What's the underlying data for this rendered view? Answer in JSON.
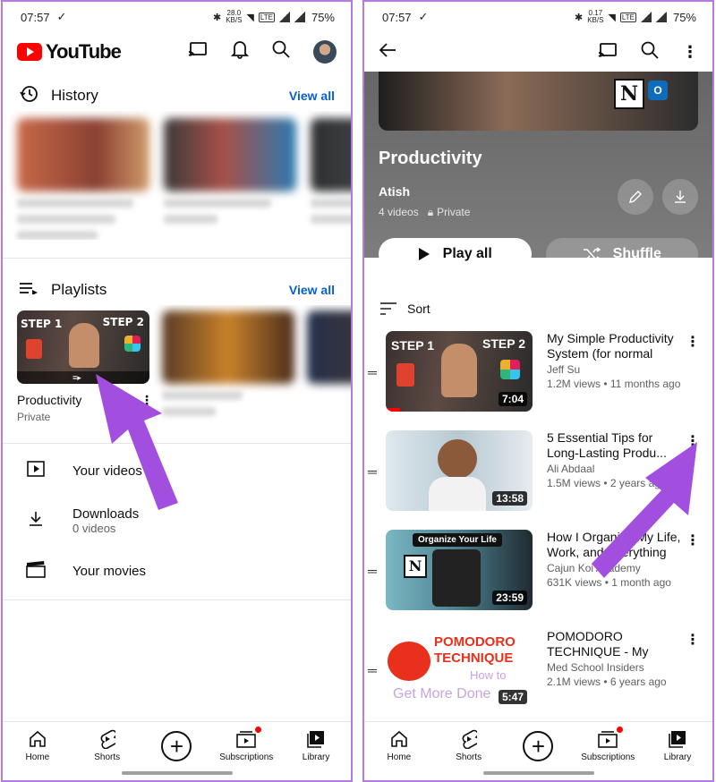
{
  "status_left": {
    "time": "07:57",
    "speed": "28.0\nKB/S",
    "battery": "75%"
  },
  "status_right": {
    "time": "07:57",
    "speed": "0.17\nKB/S",
    "battery": "75%"
  },
  "left": {
    "logo_text": "YouTube",
    "history": {
      "title": "History",
      "view_all": "View all"
    },
    "playlists": {
      "title": "Playlists",
      "view_all": "View all",
      "items": [
        {
          "title": "Productivity",
          "privacy": "Private"
        }
      ]
    },
    "menu": {
      "your_videos": "Your videos",
      "downloads": "Downloads",
      "downloads_sub": "0 videos",
      "your_movies": "Your movies"
    }
  },
  "right": {
    "playlist_title": "Productivity",
    "owner": "Atish",
    "video_count": "4 videos",
    "privacy": "Private",
    "play_all": "Play all",
    "shuffle": "Shuffle",
    "sort": "Sort",
    "videos": [
      {
        "title": "My Simple Productivity System (for normal peo...",
        "channel": "Jeff Su",
        "meta": "1.2M views • 11 months ago",
        "duration": "7:04"
      },
      {
        "title": "5 Essential Tips for Long-Lasting Produ...",
        "channel": "Ali Abdaal",
        "meta": "1.5M views • 2 years ago",
        "duration": "13:58"
      },
      {
        "title": "How I Organize My Life, Work, and Everything El...",
        "channel": "Cajun Koi Academy",
        "meta": "631K views • 1 month ago",
        "duration": "23:59"
      },
      {
        "title": "POMODORO TECHNIQUE - My Favori...",
        "channel": "Med School Insiders",
        "meta": "2.1M views • 6 years ago",
        "duration": "5:47"
      }
    ],
    "thumb_text": {
      "step1": "STEP 1",
      "step2": "STEP 2",
      "organize": "Organize Your Life",
      "pomodoro": "POMODORO",
      "technique": "TECHNIQUE",
      "howto": "How to",
      "getmore": "Get More Done"
    }
  },
  "nav": {
    "home": "Home",
    "shorts": "Shorts",
    "subscriptions": "Subscriptions",
    "library": "Library"
  },
  "colors": {
    "accent": "#065fd4",
    "brand": "#ff0000",
    "arrow": "#a24fe0"
  }
}
